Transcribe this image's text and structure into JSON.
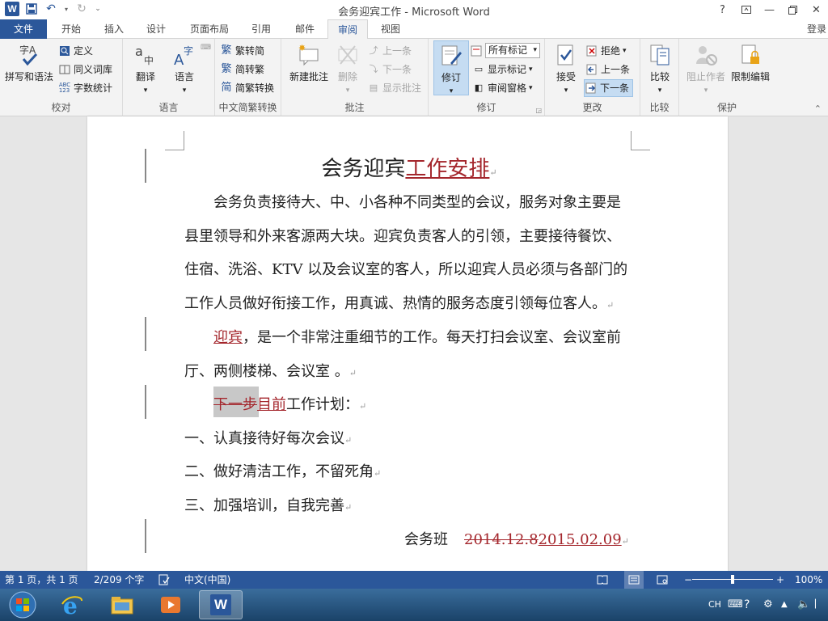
{
  "app": {
    "title": "会务迎宾工作 - Microsoft Word",
    "login_label": "登录",
    "help_icon": "?"
  },
  "tabs": [
    {
      "label": "文件"
    },
    {
      "label": "开始"
    },
    {
      "label": "插入"
    },
    {
      "label": "设计"
    },
    {
      "label": "页面布局"
    },
    {
      "label": "引用"
    },
    {
      "label": "邮件"
    },
    {
      "label": "审阅"
    },
    {
      "label": "视图"
    }
  ],
  "ribbon": {
    "proofing": {
      "group_label": "校对",
      "spelling": "拼写和语法",
      "define": "定义",
      "thesaurus": "同义词库",
      "word_count": "字数统计"
    },
    "language": {
      "group_label": "语言",
      "translate": "翻译",
      "language": "语言"
    },
    "chinese_conversion": {
      "group_label": "中文简繁转换",
      "to_traditional": "繁转简",
      "to_simplified": "简转繁",
      "convert": "简繁转换"
    },
    "comments": {
      "group_label": "批注",
      "new_comment": "新建批注",
      "delete": "删除",
      "previous": "上一条",
      "next": "下一条",
      "show_comments": "显示批注"
    },
    "tracking": {
      "group_label": "修订",
      "track_changes": "修订",
      "markup_select": "所有标记",
      "show_markup": "显示标记",
      "reviewing_pane": "审阅窗格"
    },
    "changes": {
      "group_label": "更改",
      "accept": "接受",
      "reject": "拒绝",
      "previous": "上一条",
      "next": "下一条"
    },
    "compare": {
      "group_label": "比较",
      "compare": "比较"
    },
    "protect": {
      "group_label": "保护",
      "block_authors": "阻止作者",
      "restrict_editing": "限制编辑"
    }
  },
  "document": {
    "title_plain": "会务迎宾",
    "title_inserted": "工作安排",
    "p1_l1": "会务负责接待大、中、小各种不同类型的会议，服务对象主要是",
    "p1_l2": "县里领导和外来客源两大块。迎宾负责客人的引领，主要接待餐饮、",
    "p1_l3": "住宿、洗浴、KTV 以及会议室的客人，所以迎宾人员必须与各部门的",
    "p1_l4": "工作人员做好衔接工作，用真诚、热情的服务态度引领每位客人。",
    "p2_inserted": "迎宾",
    "p2_l1_rest": "，是一个非常注重细节的工作。每天打扫会议室、会议室前",
    "p2_l2": "厅、两侧楼梯、会议室 。",
    "p3_deleted": "下一步",
    "p3_inserted": "目前",
    "p3_rest": "工作计划：",
    "item1": "一、认真接待好每次会议",
    "item2": "二、做好清洁工作，不留死角",
    "item3": "三、加强培训，自我完善",
    "sign_team": "会务班",
    "sign_date_deleted": "2014.12.8",
    "sign_date_inserted": "2015.02.09",
    "para_mark": "↵"
  },
  "status": {
    "page": "第 1 页，共 1 页",
    "words": "2/209 个字",
    "language": "中文(中国)",
    "zoom": "100%",
    "zoom_fraction": 0.5
  },
  "taskbar": {
    "ime": "CH"
  },
  "colors": {
    "word_blue": "#2b579a",
    "revision_red": "#a4262c"
  }
}
